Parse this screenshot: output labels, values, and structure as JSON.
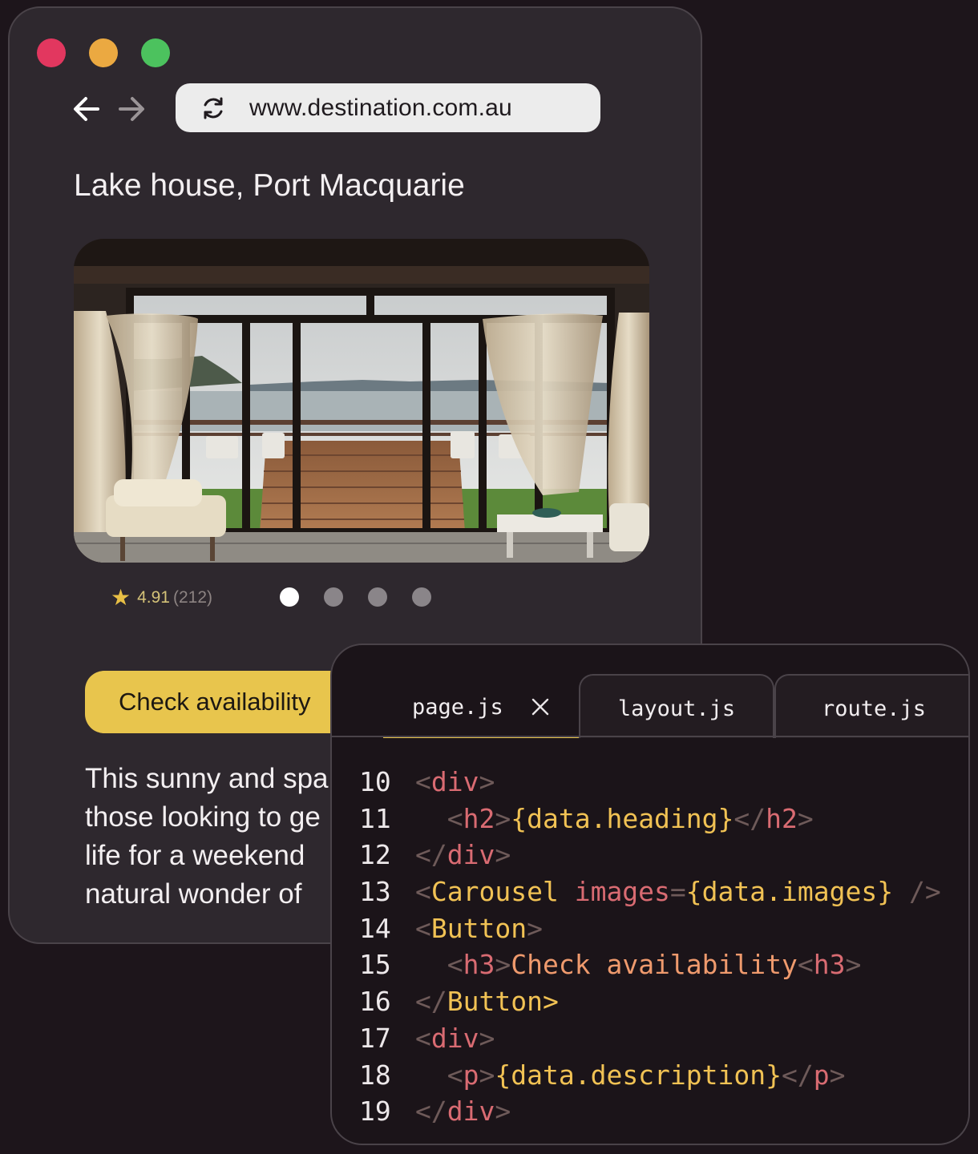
{
  "browser": {
    "url": "www.destination.com.au",
    "title": "Lake house, Port Macquarie",
    "rating": {
      "score": "4.91",
      "count": "(212)"
    },
    "carousel": {
      "count": 4,
      "active_index": 0
    },
    "cta_label": "Check availability",
    "description_lines": [
      "This sunny and spa",
      "those looking to ge",
      "life for a weekend",
      "natural wonder of"
    ]
  },
  "editor": {
    "tabs": [
      {
        "label": "page.js",
        "active": true
      },
      {
        "label": "layout.js",
        "active": false
      },
      {
        "label": "route.js",
        "active": false
      }
    ],
    "lines": [
      {
        "num": "10",
        "indent": "",
        "tokens": [
          [
            "punct",
            "<"
          ],
          [
            "tag",
            "div"
          ],
          [
            "punct",
            ">"
          ]
        ]
      },
      {
        "num": "11",
        "indent": "  ",
        "tokens": [
          [
            "punct",
            "<"
          ],
          [
            "tag",
            "h2"
          ],
          [
            "punct",
            ">"
          ],
          [
            "expr",
            "{data.heading}"
          ],
          [
            "punct",
            "</"
          ],
          [
            "tag",
            "h2"
          ],
          [
            "punct",
            ">"
          ]
        ]
      },
      {
        "num": "12",
        "indent": "",
        "tokens": [
          [
            "punct",
            "</"
          ],
          [
            "tag",
            "div"
          ],
          [
            "punct",
            ">"
          ]
        ]
      },
      {
        "num": "13",
        "indent": "",
        "tokens": [
          [
            "punct",
            "<"
          ],
          [
            "comp",
            "Carousel"
          ],
          [
            "punct",
            " "
          ],
          [
            "attr",
            "images"
          ],
          [
            "punct",
            "="
          ],
          [
            "expr",
            "{data.images}"
          ],
          [
            "punct",
            " />"
          ]
        ]
      },
      {
        "num": "14",
        "indent": "",
        "tokens": [
          [
            "punct",
            "<"
          ],
          [
            "comp",
            "Button"
          ],
          [
            "punct",
            ">"
          ]
        ]
      },
      {
        "num": "15",
        "indent": "  ",
        "tokens": [
          [
            "punct",
            "<"
          ],
          [
            "tag",
            "h3"
          ],
          [
            "punct",
            ">"
          ],
          [
            "text",
            "Check availability"
          ],
          [
            "punct",
            "<"
          ],
          [
            "tag",
            "h3"
          ],
          [
            "punct",
            ">"
          ]
        ]
      },
      {
        "num": "16",
        "indent": "",
        "tokens": [
          [
            "punct",
            "</"
          ],
          [
            "comp",
            "Button"
          ],
          [
            "comp",
            ">"
          ]
        ]
      },
      {
        "num": "17",
        "indent": "",
        "tokens": [
          [
            "punct",
            "<"
          ],
          [
            "tag",
            "div"
          ],
          [
            "punct",
            ">"
          ]
        ]
      },
      {
        "num": "18",
        "indent": "  ",
        "tokens": [
          [
            "punct",
            "<"
          ],
          [
            "tag",
            "p"
          ],
          [
            "punct",
            ">"
          ],
          [
            "expr",
            "{data.description}"
          ],
          [
            "punct",
            "</"
          ],
          [
            "tag",
            "p"
          ],
          [
            "punct",
            ">"
          ]
        ]
      },
      {
        "num": "19",
        "indent": "",
        "tokens": [
          [
            "punct",
            "</"
          ],
          [
            "tag",
            "div"
          ],
          [
            "punct",
            ">"
          ]
        ]
      }
    ]
  },
  "colors": {
    "accent": "#e8c54d",
    "close_red": "#e2375f",
    "minimize_yellow": "#eba941",
    "maximize_green": "#4cc25e"
  }
}
